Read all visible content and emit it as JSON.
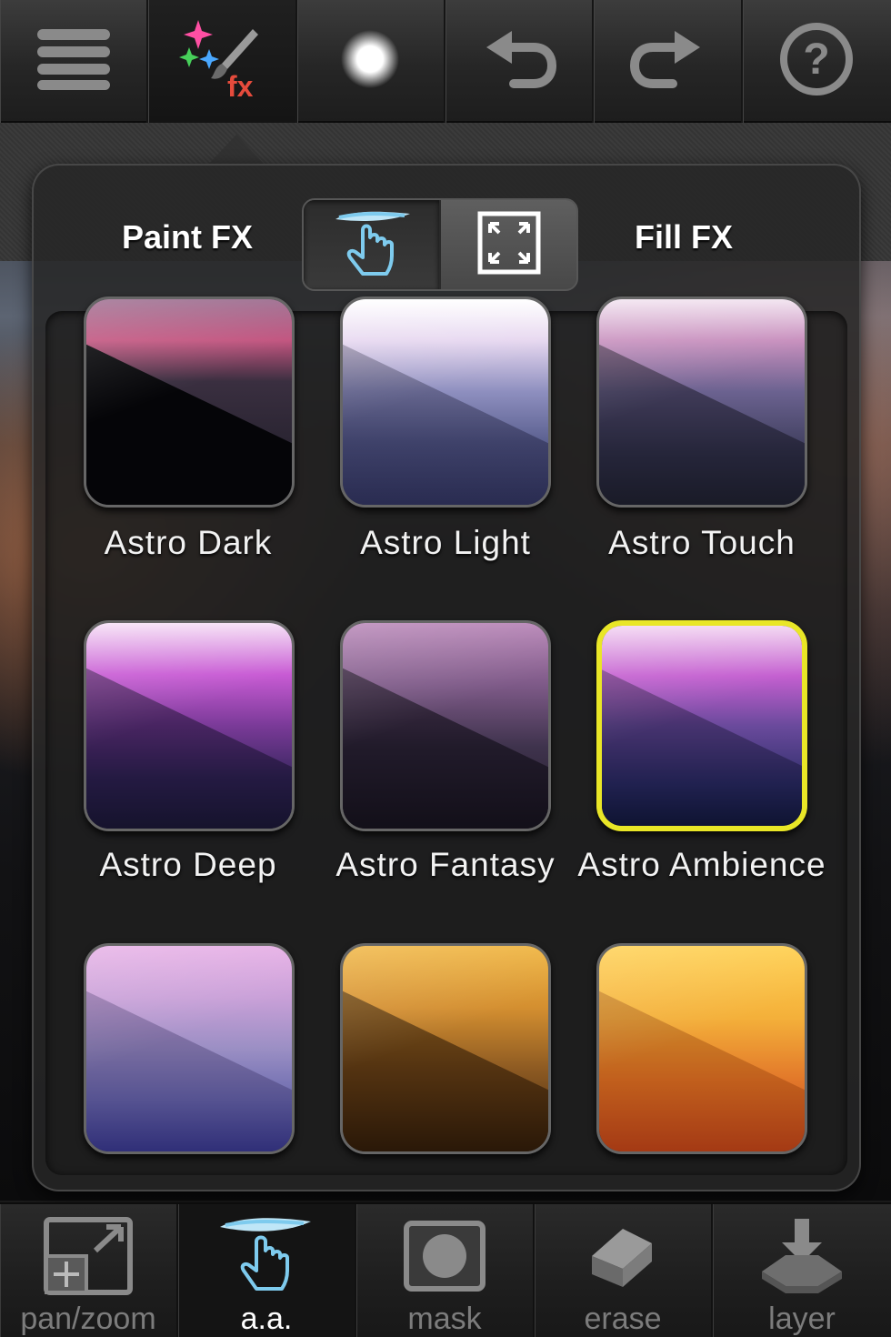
{
  "toolbar": {
    "items": [
      {
        "icon": "menu-icon",
        "active": false
      },
      {
        "icon": "paint-fx-icon",
        "active": true,
        "text": "fx"
      },
      {
        "icon": "brush-size-icon",
        "active": false
      },
      {
        "icon": "undo-icon",
        "active": false
      },
      {
        "icon": "redo-icon",
        "active": false
      },
      {
        "icon": "help-icon",
        "active": false,
        "text": "?"
      }
    ]
  },
  "popup": {
    "left_label": "Paint FX",
    "right_label": "Fill FX",
    "segment": {
      "selected": "paint",
      "options": [
        "paint-touch-icon",
        "fill-expand-icon"
      ]
    }
  },
  "effects": [
    {
      "label": "Astro Dark",
      "selected": false
    },
    {
      "label": "Astro Light",
      "selected": false
    },
    {
      "label": "Astro Touch",
      "selected": false
    },
    {
      "label": "Astro Deep",
      "selected": false
    },
    {
      "label": "Astro Fantasy",
      "selected": false
    },
    {
      "label": "Astro Ambience",
      "selected": true
    },
    {
      "label": "",
      "selected": false
    },
    {
      "label": "",
      "selected": false
    },
    {
      "label": "",
      "selected": false
    }
  ],
  "bottom_bar": {
    "items": [
      {
        "label": "pan/zoom",
        "icon": "pan-zoom-icon",
        "active": false
      },
      {
        "label": "a.a.",
        "icon": "touch-brush-icon",
        "active": true
      },
      {
        "label": "mask",
        "icon": "mask-icon",
        "active": false
      },
      {
        "label": "erase",
        "icon": "eraser-icon",
        "active": false
      },
      {
        "label": "layer",
        "icon": "layer-icon",
        "active": false
      }
    ]
  },
  "colors": {
    "selection": "#e9e627",
    "accent_blue": "#7ecbee",
    "label_inactive": "#7c7c7c"
  }
}
